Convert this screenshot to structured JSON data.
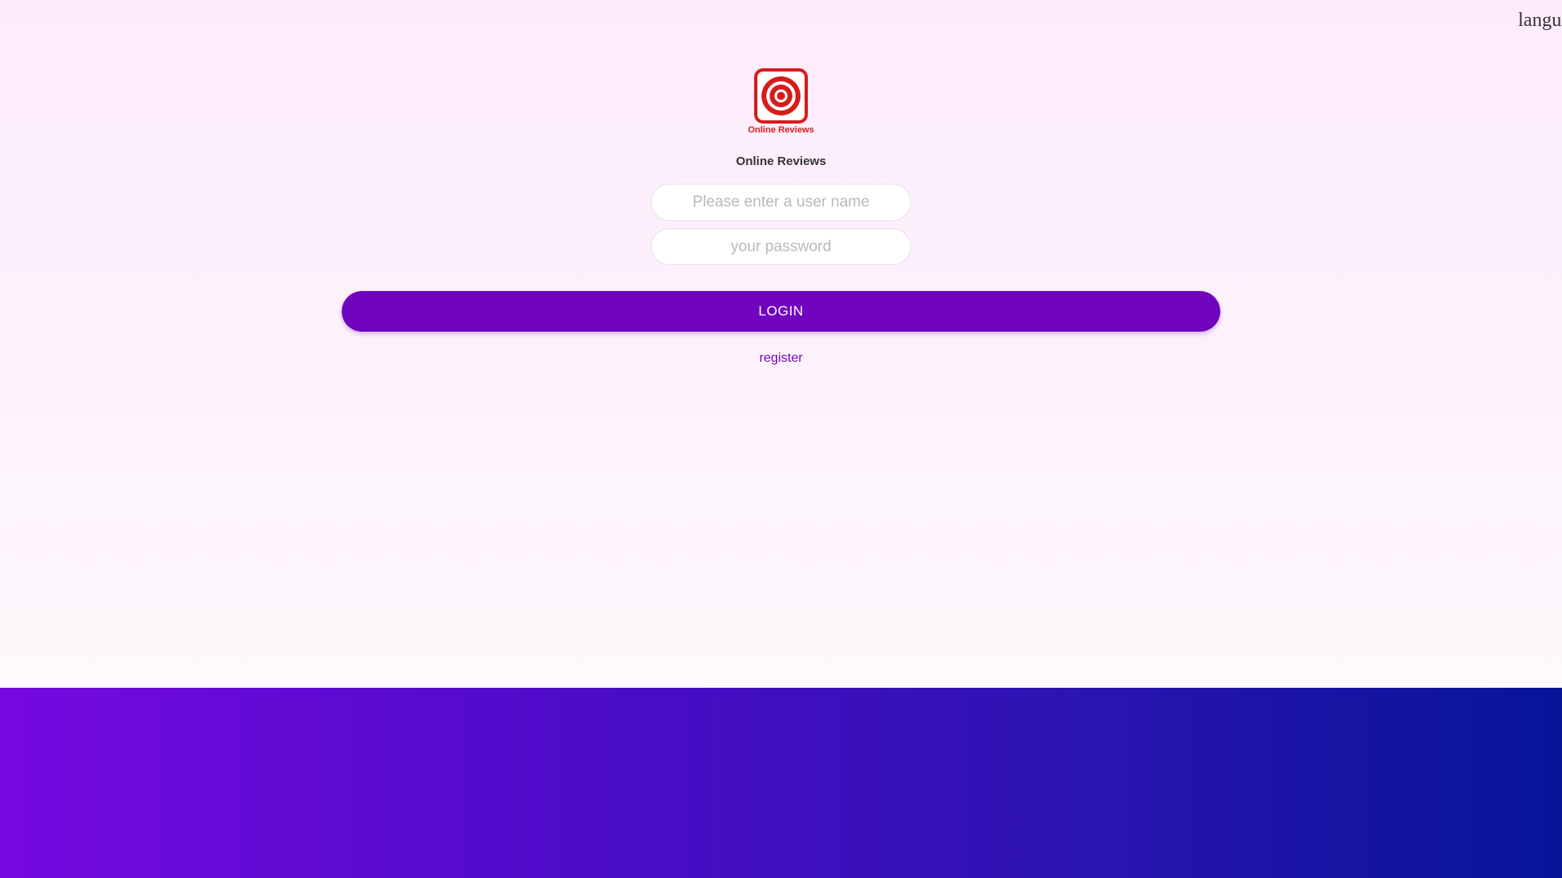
{
  "header": {
    "language_label": "langu"
  },
  "brand": {
    "logo_caption": "Online Reviews",
    "logo_icon": "target-icon",
    "logo_color": "#d71c1c",
    "app_title": "Online Reviews"
  },
  "login_form": {
    "username": {
      "placeholder": "Please enter a user name",
      "value": ""
    },
    "password": {
      "placeholder": "your password",
      "value": ""
    },
    "login_label": "LOGIN",
    "register_label": "register"
  },
  "colors": {
    "accent": "#7105bf",
    "background_top": "#fdebfc",
    "footer_left": "#7609e0",
    "footer_right": "#071599"
  }
}
